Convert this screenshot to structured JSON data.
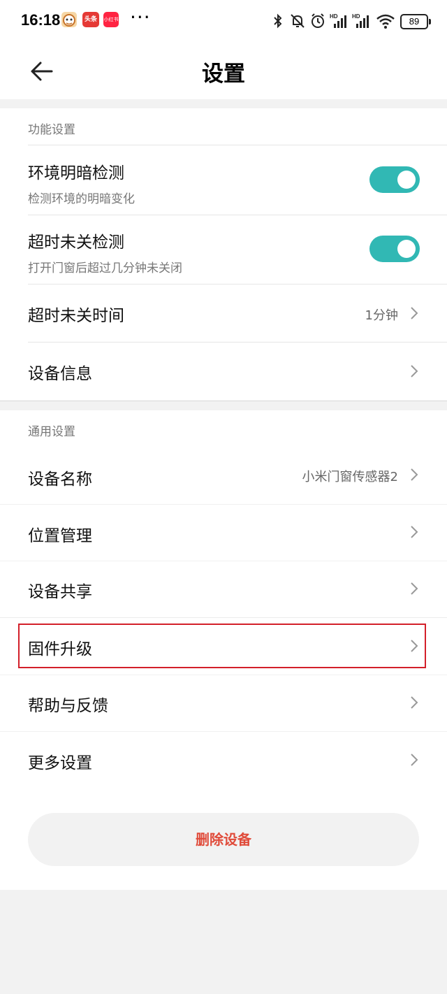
{
  "status_bar": {
    "time": "16:18",
    "more": "···",
    "battery": "89",
    "icons": [
      "app-icon-mascot",
      "app-icon-toutiao",
      "app-icon-xiaohongshu",
      "bluetooth-icon",
      "mute-icon",
      "alarm-icon",
      "signal-hd-1-icon",
      "signal-hd-2-icon",
      "wifi-icon",
      "battery-icon"
    ],
    "app_labels": {
      "toutiao": "头条",
      "xiaohongshu": "小红书"
    }
  },
  "header": {
    "title": "设置",
    "back_icon": "back-arrow-icon"
  },
  "function_settings": {
    "label": "功能设置",
    "items": [
      {
        "label": "环境明暗检测",
        "sub": "检测环境的明暗变化",
        "toggle": true
      },
      {
        "label": "超时未关检测",
        "sub": "打开门窗后超过几分钟未关闭",
        "toggle": true
      },
      {
        "label": "超时未关时间",
        "value": "1分钟"
      },
      {
        "label": "设备信息"
      }
    ]
  },
  "general_settings": {
    "label": "通用设置",
    "items": [
      {
        "label": "设备名称",
        "value": "小米门窗传感器2"
      },
      {
        "label": "位置管理"
      },
      {
        "label": "设备共享"
      },
      {
        "label": "固件升级"
      },
      {
        "label": "帮助与反馈"
      },
      {
        "label": "更多设置"
      }
    ]
  },
  "delete_button": "删除设备",
  "colors": {
    "toggle_on": "#31b8b4",
    "delete_text": "#e04b3a",
    "highlight_border": "#d31f2a"
  }
}
